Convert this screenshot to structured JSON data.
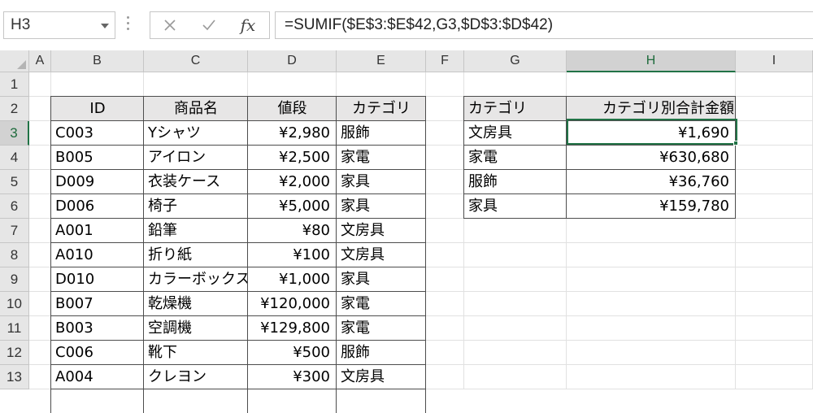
{
  "name_box": "H3",
  "formula": "=SUMIF($E$3:$E$42,G3,$D$3:$D$42)",
  "fx_label": "fx",
  "accent_color": "#217346",
  "columns": [
    "A",
    "B",
    "C",
    "D",
    "E",
    "F",
    "G",
    "H",
    "I"
  ],
  "rows": [
    "1",
    "2",
    "3",
    "4",
    "5",
    "6",
    "7",
    "8",
    "9",
    "10",
    "11",
    "12",
    "13"
  ],
  "product_table": {
    "headers": [
      "ID",
      "商品名",
      "値段",
      "カテゴリ"
    ],
    "rows": [
      [
        "C003",
        "Yシャツ",
        "¥2,980",
        "服飾"
      ],
      [
        "B005",
        "アイロン",
        "¥2,500",
        "家電"
      ],
      [
        "D009",
        "衣装ケース",
        "¥2,000",
        "家具"
      ],
      [
        "D006",
        "椅子",
        "¥5,000",
        "家具"
      ],
      [
        "A001",
        "鉛筆",
        "¥80",
        "文房具"
      ],
      [
        "A010",
        "折り紙",
        "¥100",
        "文房具"
      ],
      [
        "D010",
        "カラーボックス",
        "¥1,000",
        "家具"
      ],
      [
        "B007",
        "乾燥機",
        "¥120,000",
        "家電"
      ],
      [
        "B003",
        "空調機",
        "¥129,800",
        "家電"
      ],
      [
        "C006",
        "靴下",
        "¥500",
        "服飾"
      ],
      [
        "A004",
        "クレヨン",
        "¥300",
        "文房具"
      ]
    ]
  },
  "summary_table": {
    "headers": [
      "カテゴリ",
      "カテゴリ別合計金額"
    ],
    "rows": [
      [
        "文房具",
        "¥1,690"
      ],
      [
        "家電",
        "¥630,680"
      ],
      [
        "服飾",
        "¥36,760"
      ],
      [
        "家具",
        "¥159,780"
      ]
    ]
  }
}
